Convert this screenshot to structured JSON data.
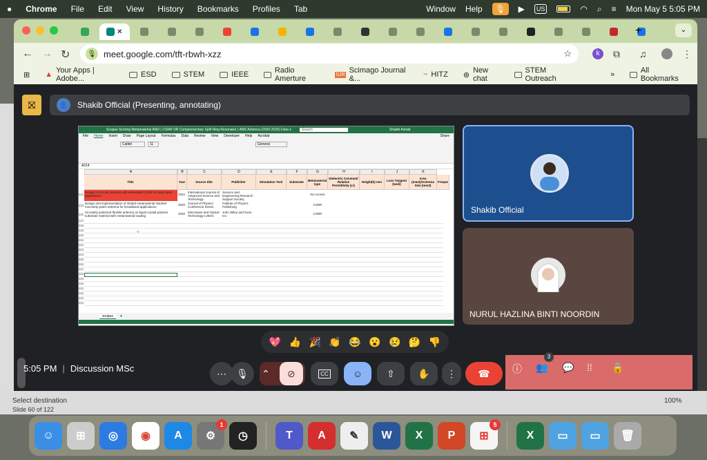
{
  "menubar": {
    "apple": "",
    "app": "Chrome",
    "items": [
      "File",
      "Edit",
      "View",
      "History",
      "Bookmarks",
      "Profiles",
      "Tab"
    ],
    "right_items": [
      "Window",
      "Help"
    ],
    "input_source": "US",
    "datetime": "Mon May 5  5:05 PM"
  },
  "browser": {
    "url": "meet.google.com/tft-rbwh-xzz",
    "profile_letter": "k",
    "bookmarks": [
      {
        "label": "Your Apps | Adobe..."
      },
      {
        "label": "ESD"
      },
      {
        "label": "STEM"
      },
      {
        "label": "IEEE"
      },
      {
        "label": "Radio Amerture"
      },
      {
        "label": "Scimago Journal &..."
      },
      {
        "label": "HITZ"
      },
      {
        "label": "New chat"
      },
      {
        "label": "STEM Outreach"
      }
    ],
    "all_bookmarks": "All Bookmarks"
  },
  "meet": {
    "presenter_label": "Shakib Official (Presenting, annotating)",
    "participants": [
      {
        "name": "Shakib Official"
      },
      {
        "name": "NURUL HAZLINA BINTI NOORDIN"
      }
    ],
    "time": "5:05 PM",
    "meeting_name": "Discussion MSc",
    "people_count": "3",
    "reactions": [
      "💖",
      "👍",
      "🎉",
      "👏",
      "😂",
      "😮",
      "😢",
      "🤔",
      "👎"
    ]
  },
  "spreadsheet": {
    "window_title": "Scopus Scoring Metamaterial AND ( CSRR OR Complementary Split Ring Resonator ) AND Antenna (2020-2025)-Data-1 - Excel",
    "search_placeholder": "Search",
    "user": "Shakib Ashab",
    "share": "Share",
    "tabs": [
      "File",
      "Home",
      "Insert",
      "Draw",
      "Page Layout",
      "Formulas",
      "Data",
      "Review",
      "View",
      "Developer",
      "Help",
      "Acrobat"
    ],
    "cell_ref": "A214",
    "font": "Calibri",
    "font_size": "11",
    "number_format": "General",
    "columns": [
      "A",
      "B",
      "C",
      "D",
      "E",
      "F",
      "G",
      "H",
      "I",
      "J",
      "K"
    ],
    "headers": [
      "Title",
      "Year",
      "Source title",
      "Publisher",
      "Simulation Tool",
      "Substrate",
      "Metamaterial type",
      "Dielectric Constant/ Relative Permittivity (εr)",
      "Height(h) mm",
      "Loss Tangent (tanδ)",
      "Area (mm2)/Antenna Size (mm3)",
      "Freque"
    ],
    "rows": [
      {
        "num": "214",
        "title": "Design of circular antenna with embedded CSRR for wide band applications",
        "year": "2022",
        "source": "International Journal of Advanced Science and Technology",
        "publisher": "Science and Engineering Research Support Society",
        "type": "No Access"
      },
      {
        "num": "215",
        "title": "Design and implementation of slotted metamaterial stacked microstrip patch antenna for broadband applications",
        "year": "2020",
        "source": "Journal of Physics: Conference Series",
        "publisher": "Institute of Physics Publishing",
        "type": "CSRR"
      },
      {
        "num": "216",
        "title": "Circularly polarized flexible antenna on liquid crystal polymer substrate material with metamaterial loading",
        "year": "2020",
        "source": "Microwave and Optical Technology Letters",
        "publisher": "John Wiley and Sons Inc.",
        "type": "CSRR"
      }
    ],
    "empty_row_nums": [
      "217",
      "218",
      "219",
      "220",
      "221",
      "222",
      "223",
      "224",
      "225",
      "226",
      "227",
      "228",
      "229",
      "230",
      "231",
      "232",
      "233",
      "234"
    ],
    "sheet_tab": "scopus"
  },
  "background_app": {
    "select_destination": "Select destination",
    "slide": "Slide 60 of 122",
    "zoom": "100%"
  },
  "dock": {
    "badges": {
      "settings": "1",
      "store": "5"
    }
  },
  "colors": {
    "chrome_frame": "#c7d9a8",
    "meet_bg": "#202124",
    "end_call": "#ea4335",
    "excel_green": "#217346",
    "highlight_red": "#ea4335"
  }
}
